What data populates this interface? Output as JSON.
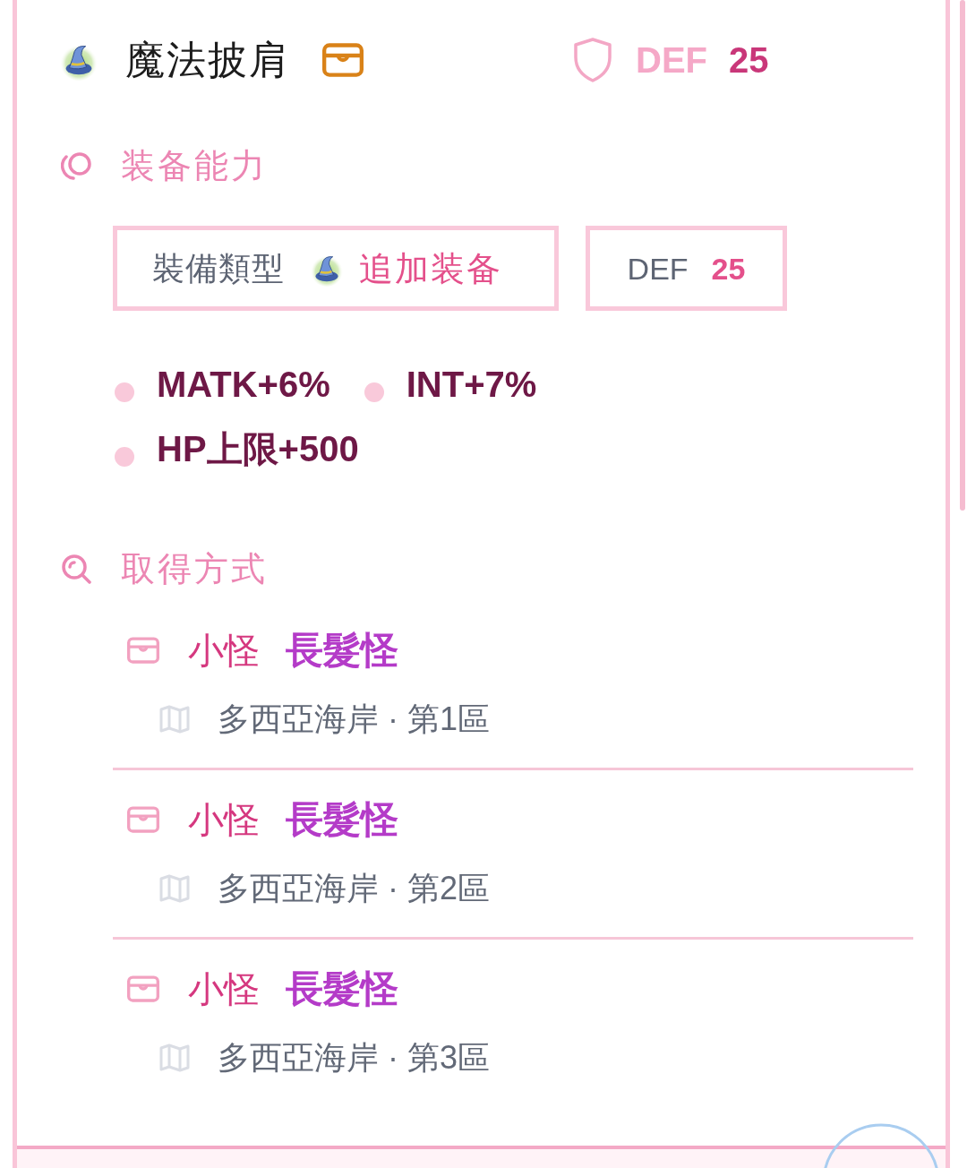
{
  "item": {
    "name": "魔法披肩",
    "def_label": "DEF",
    "def_value": "25"
  },
  "abilities": {
    "title": "装备能力",
    "type_label": "裝備類型",
    "type_value": "追加装备",
    "def_label": "DEF",
    "def_value": "25",
    "stats": [
      "MATK+6%",
      "INT+7%",
      "HP上限+500"
    ]
  },
  "sources": {
    "title": "取得方式",
    "items": [
      {
        "category": "小怪",
        "monster": "長髮怪",
        "location": "多西亞海岸 · 第1區"
      },
      {
        "category": "小怪",
        "monster": "長髮怪",
        "location": "多西亞海岸 · 第2區"
      },
      {
        "category": "小怪",
        "monster": "長髮怪",
        "location": "多西亞海岸 · 第3區"
      }
    ]
  }
}
